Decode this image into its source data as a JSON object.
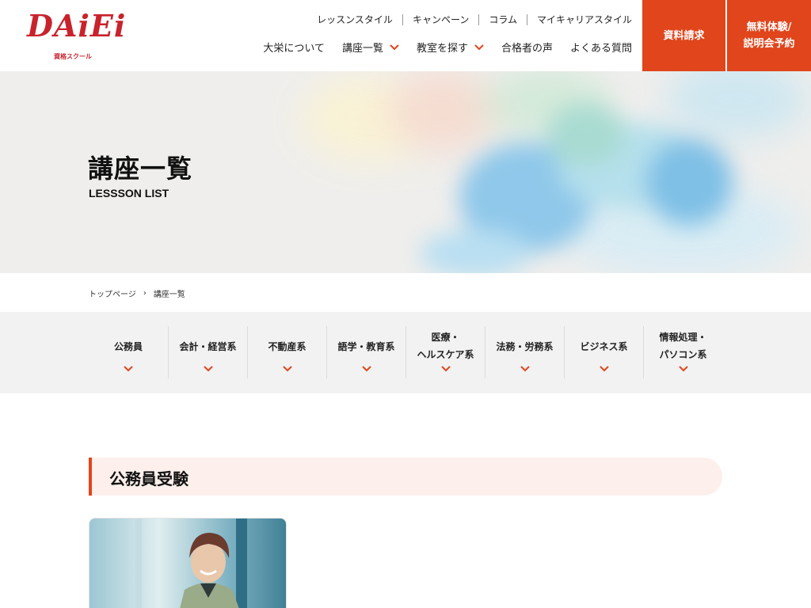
{
  "brand": {
    "logo_text": "DAiEi",
    "logo_sub": "資格スクール",
    "accent_color": "#e0451c"
  },
  "header": {
    "subnav": [
      "レッスンスタイル",
      "キャンペーン",
      "コラム",
      "マイキャリアスタイル"
    ],
    "mainnav": [
      {
        "label": "大栄について",
        "has_dropdown": false
      },
      {
        "label": "講座一覧",
        "has_dropdown": true
      },
      {
        "label": "教室を探す",
        "has_dropdown": true
      },
      {
        "label": "合格者の声",
        "has_dropdown": false
      },
      {
        "label": "よくある質問",
        "has_dropdown": false
      }
    ],
    "cta_docs": "資料請求",
    "cta_trial_line1": "無料体験/",
    "cta_trial_line2": "説明会予約"
  },
  "hero": {
    "title": "講座一覧",
    "subtitle": "LESSSON LIST"
  },
  "breadcrumb": {
    "home": "トップページ",
    "separator": "›",
    "current": "講座一覧"
  },
  "categories": [
    {
      "label": "公務員",
      "icon": "chevron-down-icon"
    },
    {
      "label": "会計・経営系",
      "icon": "chevron-down-icon"
    },
    {
      "label": "不動産系",
      "icon": "chevron-down-icon"
    },
    {
      "label": "語学・教育系",
      "icon": "chevron-down-icon"
    },
    {
      "label": "医療・\nヘルスケア系",
      "icon": "chevron-down-icon"
    },
    {
      "label": "法務・労務系",
      "icon": "chevron-down-icon"
    },
    {
      "label": "ビジネス系",
      "icon": "chevron-down-icon"
    },
    {
      "label": "情報処理・\nパソコン系",
      "icon": "chevron-down-icon"
    }
  ],
  "section": {
    "title": "公務員受験"
  }
}
